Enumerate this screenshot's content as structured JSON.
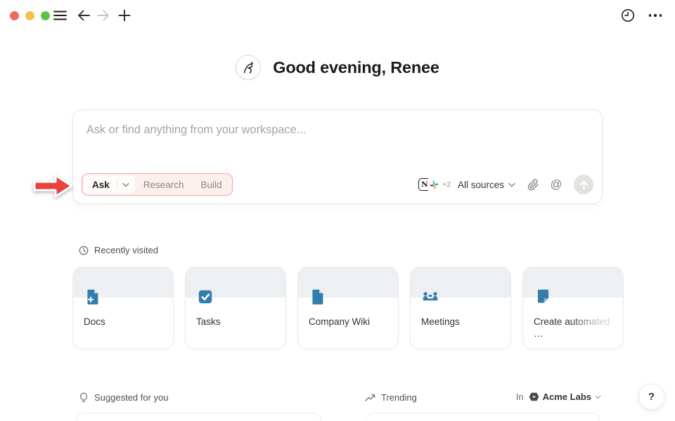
{
  "colors": {
    "accent_blue": "#327eaa",
    "annotation_red": "#e8433c",
    "highlight_border": "#f0a8a7",
    "highlight_fill": "#fcf0ef",
    "card_band": "#edf0f3",
    "traffic_red": "#ed6a5e",
    "traffic_yellow": "#f4bf4f",
    "traffic_green": "#5ec443"
  },
  "greeting": {
    "title": "Good evening, Renee"
  },
  "composer": {
    "placeholder": "Ask or find anything from your workspace...",
    "modes": [
      {
        "label": "Ask",
        "selected": true,
        "has_dropdown": true
      },
      {
        "label": "Research",
        "selected": false
      },
      {
        "label": "Build",
        "selected": false
      }
    ],
    "sources": {
      "connectors": [
        "notion",
        "slack"
      ],
      "extra_count": "+2",
      "label": "All sources"
    }
  },
  "recently_visited": {
    "title": "Recently visited",
    "cards": [
      {
        "label": "Docs",
        "icon": "doc-add-icon"
      },
      {
        "label": "Tasks",
        "icon": "checkbox-icon"
      },
      {
        "label": "Company Wiki",
        "icon": "page-icon"
      },
      {
        "label": "Meetings",
        "icon": "meeting-icon"
      },
      {
        "label": "Create automated …",
        "icon": "template-icon",
        "truncated": true
      }
    ]
  },
  "footer": {
    "suggested_title": "Suggested for you",
    "trending_title": "Trending",
    "workspace": {
      "prefix": "In",
      "name": "Acme Labs"
    },
    "help_label": "?"
  }
}
